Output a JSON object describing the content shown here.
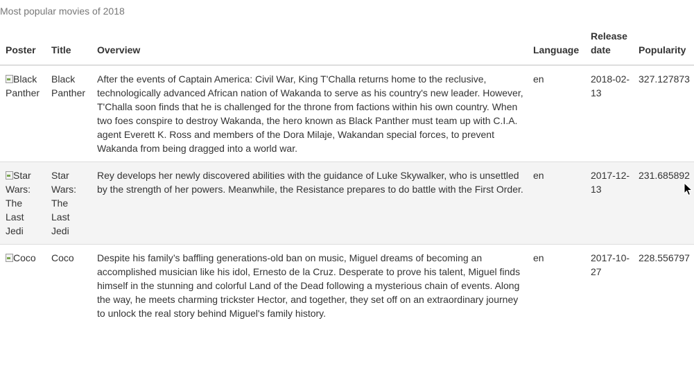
{
  "caption": "Most popular movies of 2018",
  "columns": {
    "poster": "Poster",
    "title": "Title",
    "overview": "Overview",
    "language": "Language",
    "release_date": "Release date",
    "popularity": "Popularity"
  },
  "movies": [
    {
      "poster_alt": "Black Panther",
      "title": "Black Panther",
      "overview": "After the events of Captain America: Civil War, King T'Challa returns home to the reclusive, technologically advanced African nation of Wakanda to serve as his country's new leader. However, T'Challa soon finds that he is challenged for the throne from factions within his own country. When two foes conspire to destroy Wakanda, the hero known as Black Panther must team up with C.I.A. agent Everett K. Ross and members of the Dora Milaje, Wakandan special forces, to prevent Wakanda from being dragged into a world war.",
      "language": "en",
      "release_date": "2018-02-13",
      "popularity": "327.127873"
    },
    {
      "poster_alt": "Star Wars: The Last Jedi",
      "title": "Star Wars: The Last Jedi",
      "overview": "Rey develops her newly discovered abilities with the guidance of Luke Skywalker, who is unsettled by the strength of her powers. Meanwhile, the Resistance prepares to do battle with the First Order.",
      "language": "en",
      "release_date": "2017-12-13",
      "popularity": "231.685892"
    },
    {
      "poster_alt": "Coco",
      "title": "Coco",
      "overview": "Despite his family’s baffling generations-old ban on music, Miguel dreams of becoming an accomplished musician like his idol, Ernesto de la Cruz. Desperate to prove his talent, Miguel finds himself in the stunning and colorful Land of the Dead following a mysterious chain of events. Along the way, he meets charming trickster Hector, and together, they set off on an extraordinary journey to unlock the real story behind Miguel's family history.",
      "language": "en",
      "release_date": "2017-10-27",
      "popularity": "228.556797"
    }
  ],
  "icons": {
    "broken_image": "broken-image-icon",
    "cursor": "mouse-pointer-icon"
  }
}
